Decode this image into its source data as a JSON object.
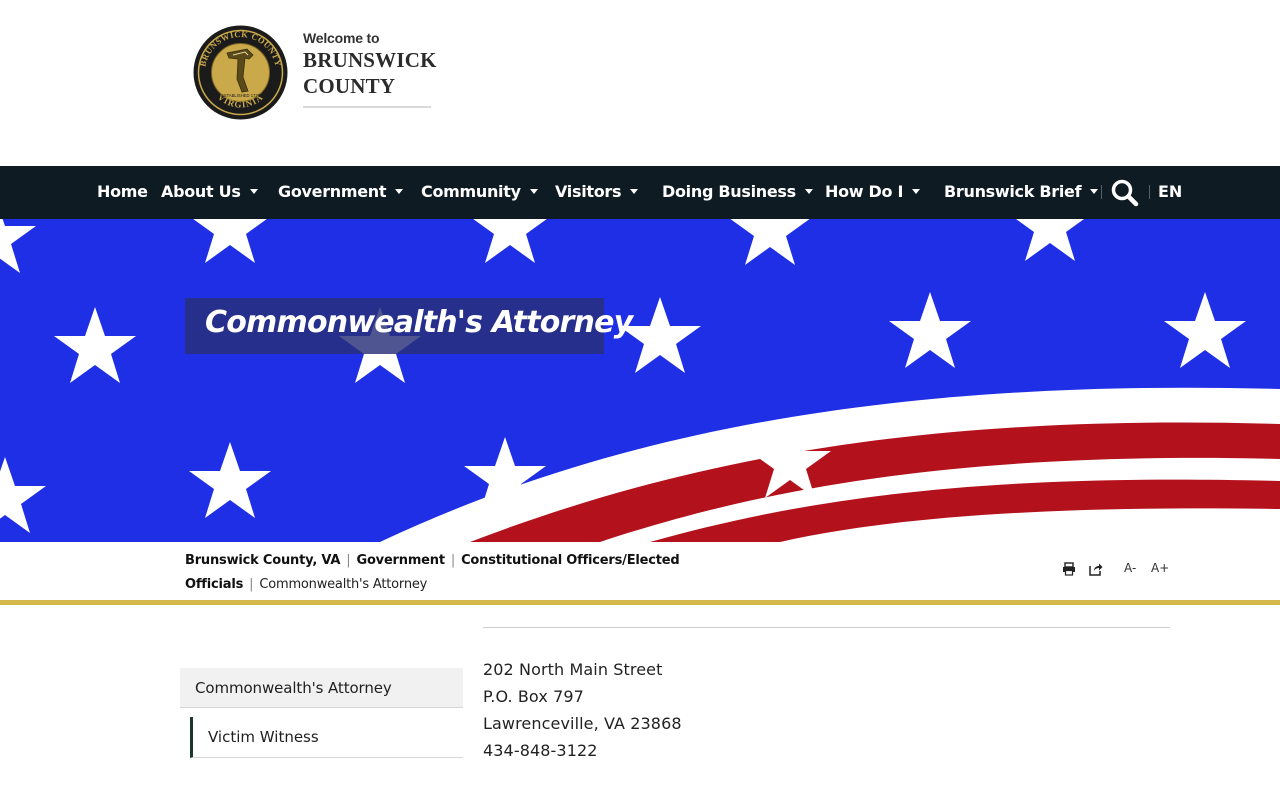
{
  "header": {
    "welcome": "Welcome to",
    "county_line1": "BRUNSWICK",
    "county_line2": "COUNTY",
    "seal_text_top": "BRUNSWICK COUNTY",
    "seal_text_bottom": "VIRGINIA",
    "seal_text_center": "ESTABLISHED 1720"
  },
  "nav": {
    "items": [
      {
        "label": "Home"
      },
      {
        "label": "About Us"
      },
      {
        "label": "Government"
      },
      {
        "label": "Community"
      },
      {
        "label": "Visitors"
      },
      {
        "label": "Doing Business"
      },
      {
        "label": "How Do I"
      },
      {
        "label": "Brunswick Brief"
      }
    ],
    "language": "EN"
  },
  "banner": {
    "title": "Commonwealth's Attorney"
  },
  "breadcrumb": {
    "items": [
      "Brunswick County, VA",
      "Government",
      "Constitutional Officers/Elected Officials"
    ],
    "current": "Commonwealth's Attorney"
  },
  "tools": {
    "font_smaller": "A-",
    "font_larger": "A+"
  },
  "sidebar": {
    "items": [
      {
        "label": "Commonwealth's Attorney"
      },
      {
        "label": "Victim Witness"
      }
    ]
  },
  "contact": {
    "street": "202 North Main Street",
    "po_box": "P.O. Box 797",
    "city_state_zip": "Lawrenceville, VA 23868",
    "phone": "434-848-3122"
  },
  "colors": {
    "nav_bg": "#0f1b22",
    "gold_rule": "#d4b84a",
    "flag_blue": "#1f2fe6",
    "flag_red": "#b3121c",
    "title_box": "#283078"
  }
}
